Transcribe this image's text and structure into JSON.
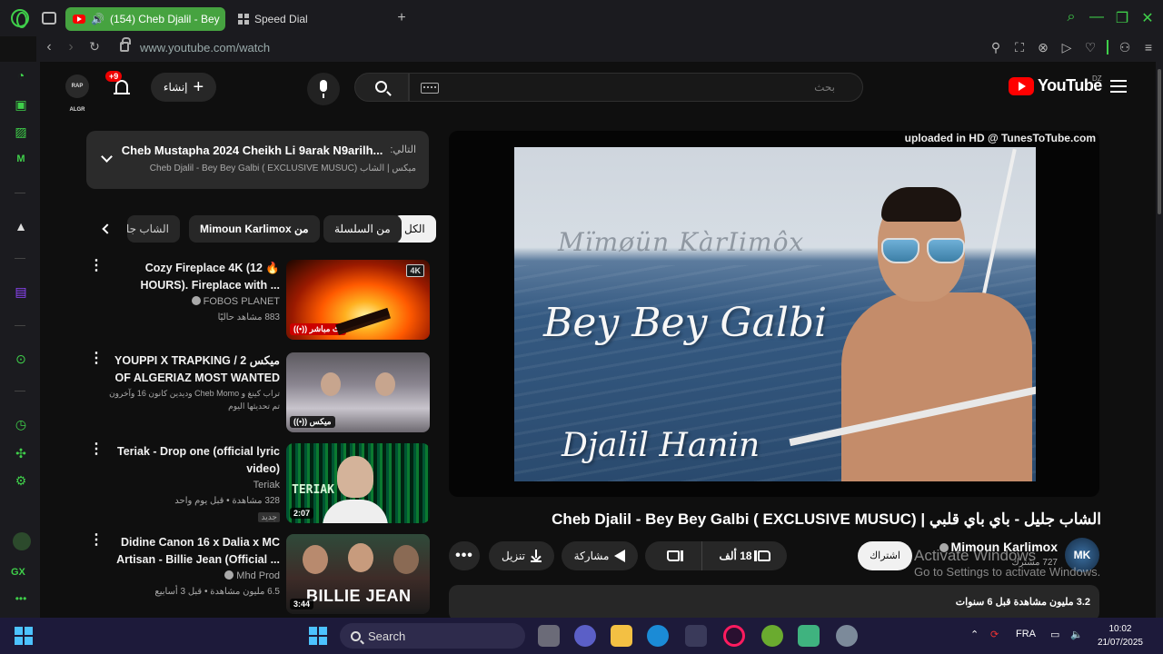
{
  "browser": {
    "tabs": [
      {
        "label": "(154) Cheb Djalil - Bey",
        "active": true
      },
      {
        "label": "Speed Dial",
        "active": false
      }
    ],
    "address": "www.youtube.com/watch",
    "accent": "#3fcf4a"
  },
  "sidebar_icons": [
    "speedometer-icon",
    "shopping-bag-icon",
    "wallet-icon",
    "gx-corner-icon",
    "aria-icon",
    "twitch-icon",
    "player-icon",
    "history-icon",
    "extensions-icon",
    "settings-icon"
  ],
  "sidebar_label": "GX",
  "masthead": {
    "logo_text": "YouTube",
    "region": "DZ",
    "search_placeholder": "بحث",
    "create_label": "إنشاء",
    "notif_count": "+9",
    "avatar_text": "RAP ALGR"
  },
  "up_next": {
    "prefix": "التالي:",
    "title": "Cheb Mustapha 2024 Cheikh Li 9arak N9arilh...",
    "playlist": "ميكس | الشاب Cheb Djalil - Bey Bey Galbi ( EXCLUSIVE MUSUC)"
  },
  "chips": {
    "all": "الكل",
    "series": "من السلسلة",
    "uploader": "من Mimoun Karlimox",
    "more": "الشاب جليل"
  },
  "related": [
    {
      "title": "Cozy Fireplace 4K (12 🔥 HOURS). Fireplace with ...",
      "channel": "FOBOS PLANET",
      "meta": "883 مشاهد حاليًا",
      "badge": "((•)) بث مباشر",
      "hd": "4K"
    },
    {
      "title": "ميكس YOUPPI X TRAPKING / 2 OF ALGERIAZ MOST WANTED",
      "channel": "تراب كينغ و Cheb Momo وديدين كانون 16 وآخرون",
      "meta": "تم تحديثها اليوم",
      "badge": "((•)) ميكس"
    },
    {
      "title": "Teriak - Drop one (official lyric video)",
      "channel": "Teriak",
      "meta": "328 مشاهدة • قبل يوم واحد",
      "meta2": "جديد",
      "badge": "2:07",
      "thumb_text": "TERIAK"
    },
    {
      "title": "Didine Canon 16 x Dalia x MC Artisan - Billie Jean (Official ...",
      "channel": "Mhd Prod",
      "meta": "6.5 مليون مشاهدة • قبل 3 أسابيع",
      "badge": "3:44",
      "thumb_text": "BILLIE JEAN"
    }
  ],
  "player": {
    "watermark": "uploaded in HD @ TunesToTube.com",
    "artist_credit": "Mïmøün KàrIimôx",
    "song_title": "Bey Bey Galbi",
    "singer": "Djalil Hanin"
  },
  "video": {
    "title": "الشاب جليل - باي باي قلبي | Cheb Djalil - Bey Bey Galbi ( EXCLUSIVE MUSUC)",
    "channel": "Mimoun Karlimox",
    "subs": "727 مشترك",
    "channel_avatar": "MK",
    "subscribe": "اشتراك",
    "likes": "18 ألف",
    "share": "مشاركة",
    "download": "تنزيل",
    "more": "•••",
    "stats": "3.2 مليون مشاهدة  قبل 6 سنوات"
  },
  "activation": {
    "title": "Activate Windows",
    "sub": "Go to Settings to activate Windows."
  },
  "taskbar": {
    "search_label": "Search",
    "lang": "FRA",
    "time": "10:02",
    "date": "21/07/2025"
  }
}
